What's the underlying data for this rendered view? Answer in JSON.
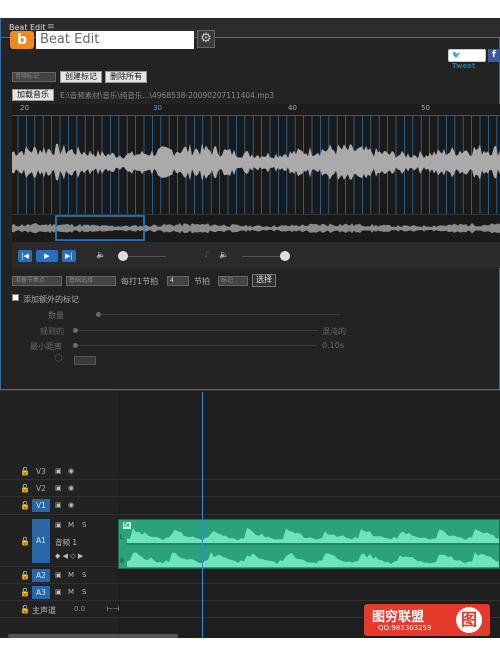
{
  "panel": {
    "title": "Beat Edit",
    "menu_icon": "≡"
  },
  "plugin": {
    "logo_letter": "b",
    "name": "Beat Edit",
    "tweet": "Tweet",
    "fb": "f"
  },
  "toolbar": {
    "dropdown1": "音频标记",
    "create_marker": "创建标记",
    "delete_all": "删除所有",
    "load_music": "加载音乐",
    "file_path": "E:\\音频素材\\音乐\\纯音乐...\\4968538-20090207111404.mp3"
  },
  "ruler": {
    "labels": [
      "20",
      "30",
      "40",
      "50"
    ]
  },
  "transport": {
    "prev": "|◀",
    "play": "▶",
    "next": "▶|"
  },
  "beats": {
    "dropdown_a": "准备节奏点",
    "dropdown_b": "基础选择",
    "every_label": "每打1节拍",
    "every_value": "4",
    "beat_label": "节拍",
    "dropdown_c": "标记",
    "select_btn": "选择"
  },
  "extra": {
    "checkbox_label": "添加额外的标记",
    "quantity": "数量",
    "evenness": "规则的",
    "chaotic": "混沌的",
    "min_distance": "最小距离",
    "min_value": "0.10s"
  },
  "tracks": [
    {
      "name": "V3"
    },
    {
      "name": "V2"
    },
    {
      "name": "V1"
    },
    {
      "name": "A1",
      "label": "音频 1"
    },
    {
      "name": "A2"
    },
    {
      "name": "A3"
    }
  ],
  "master": {
    "label": "主声道",
    "value": "0.0"
  },
  "watermark": {
    "title": "图穷联盟",
    "qq": "QQ:985303259",
    "symbol": "图"
  },
  "colors": {
    "accent": "#2a6fbf",
    "clip": "#2aa37a",
    "logo": "#f08a1e",
    "watermark": "#e5392c"
  }
}
